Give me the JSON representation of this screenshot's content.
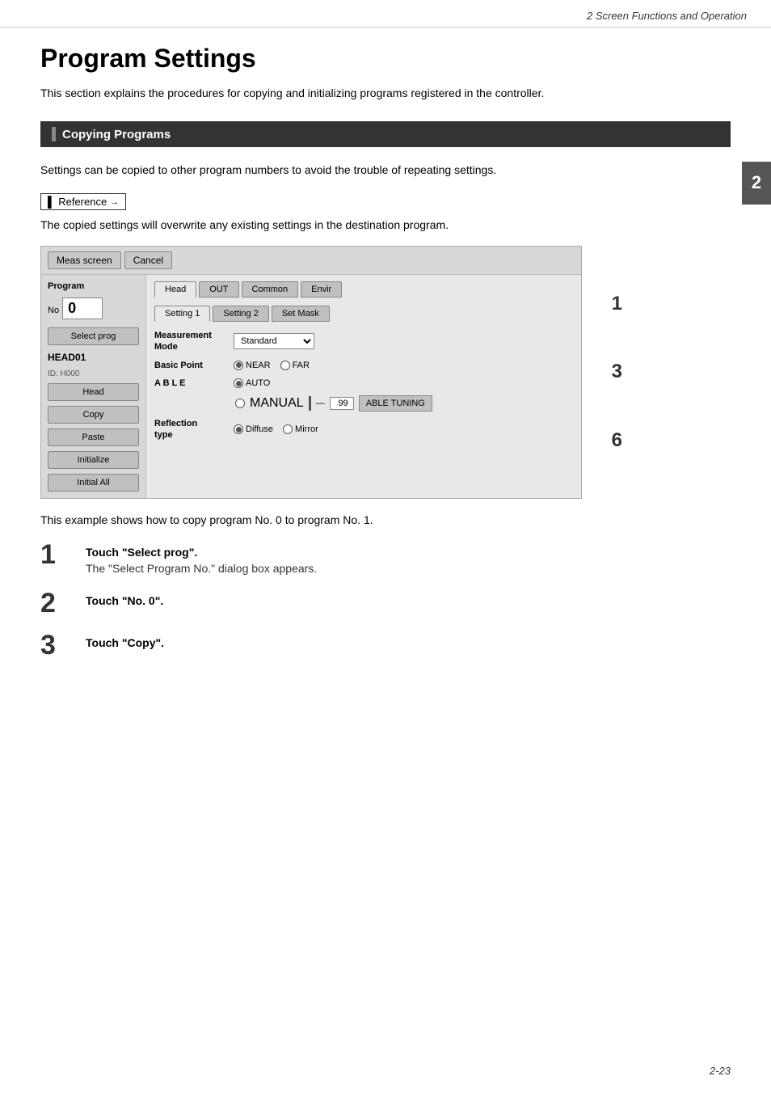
{
  "header": {
    "chapter": "2  Screen Functions and Operation"
  },
  "page": {
    "title": "Program Settings",
    "description": "This section explains the procedures for copying and initializing programs registered in the controller.",
    "section": {
      "title": "Copying Programs",
      "description": "Settings can be copied to other program numbers to avoid the trouble of repeating settings.",
      "reference_label": "Reference",
      "copied_note": "The copied settings will overwrite any existing settings in the destination program."
    },
    "example_note": "This example shows how to copy program No. 0 to program No. 1.",
    "steps": [
      {
        "number": "1",
        "title": "Touch \"Select prog\".",
        "desc": "The \"Select Program No.\" dialog box appears."
      },
      {
        "number": "2",
        "title": "Touch \"No. 0\".",
        "desc": ""
      },
      {
        "number": "3",
        "title": "Touch \"Copy\".",
        "desc": ""
      }
    ]
  },
  "ui": {
    "toolbar": {
      "meas_screen": "Meas screen",
      "cancel": "Cancel"
    },
    "tabs": {
      "head": "Head",
      "out": "OUT",
      "common": "Common",
      "envir": "Envir"
    },
    "subtabs": {
      "setting1": "Setting 1",
      "setting2": "Setting 2",
      "set_mask": "Set Mask"
    },
    "sidebar": {
      "program_label": "Program",
      "program_no": "No. 0",
      "select_prog": "Select prog",
      "head_label": "HEAD01",
      "id_label": "ID: H000",
      "head_btn": "Head",
      "copy_btn": "Copy",
      "paste_btn": "Paste",
      "initialize_btn": "Initialize",
      "initial_all_btn": "Initial All"
    },
    "fields": {
      "measurement_mode_label": "Measurement\nMode",
      "measurement_mode_value": "Standard",
      "basic_point_label": "Basic Point",
      "near_label": "NEAR",
      "far_label": "FAR",
      "able_label": "A B L E",
      "auto_label": "AUTO",
      "manual_label": "MANUAL",
      "manual_value": "99",
      "able_tuning_btn": "ABLE TUNING",
      "reflection_type_label": "Reflection\ntype",
      "diffuse_label": "Diffuse",
      "mirror_label": "Mirror"
    }
  },
  "side_numbers": [
    "1",
    "3",
    "6"
  ],
  "footer": {
    "page": "2-23"
  }
}
